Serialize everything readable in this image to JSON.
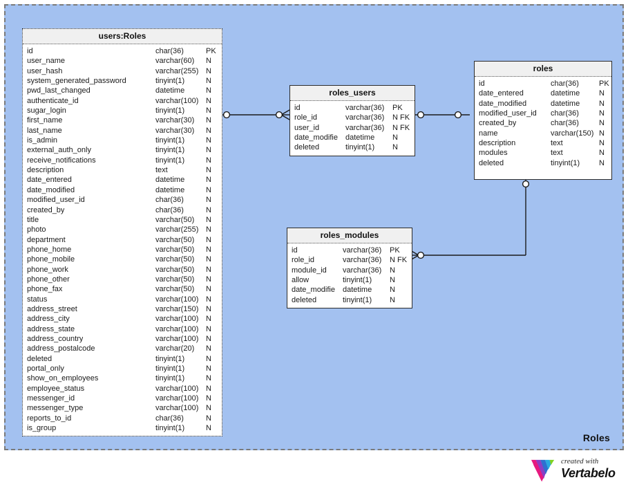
{
  "diagram": {
    "title": "Roles",
    "background_color": "#a3c1f0",
    "border_style": "dashed",
    "notation": "crow's-foot"
  },
  "tables": {
    "users": {
      "name": "users:Roles",
      "border_style": "dotted",
      "columns": [
        {
          "name": "id",
          "type": "char(36)",
          "flags": "PK"
        },
        {
          "name": "user_name",
          "type": "varchar(60)",
          "flags": "N"
        },
        {
          "name": "user_hash",
          "type": "varchar(255)",
          "flags": "N"
        },
        {
          "name": "system_generated_password",
          "type": "tinyint(1)",
          "flags": "N"
        },
        {
          "name": "pwd_last_changed",
          "type": "datetime",
          "flags": "N"
        },
        {
          "name": "authenticate_id",
          "type": "varchar(100)",
          "flags": "N"
        },
        {
          "name": "sugar_login",
          "type": "tinyint(1)",
          "flags": "N"
        },
        {
          "name": "first_name",
          "type": "varchar(30)",
          "flags": "N"
        },
        {
          "name": "last_name",
          "type": "varchar(30)",
          "flags": "N"
        },
        {
          "name": "is_admin",
          "type": "tinyint(1)",
          "flags": "N"
        },
        {
          "name": "external_auth_only",
          "type": "tinyint(1)",
          "flags": "N"
        },
        {
          "name": "receive_notifications",
          "type": "tinyint(1)",
          "flags": "N"
        },
        {
          "name": "description",
          "type": "text",
          "flags": "N"
        },
        {
          "name": "date_entered",
          "type": "datetime",
          "flags": "N"
        },
        {
          "name": "date_modified",
          "type": "datetime",
          "flags": "N"
        },
        {
          "name": "modified_user_id",
          "type": "char(36)",
          "flags": "N"
        },
        {
          "name": "created_by",
          "type": "char(36)",
          "flags": "N"
        },
        {
          "name": "title",
          "type": "varchar(50)",
          "flags": "N"
        },
        {
          "name": "photo",
          "type": "varchar(255)",
          "flags": "N"
        },
        {
          "name": "department",
          "type": "varchar(50)",
          "flags": "N"
        },
        {
          "name": "phone_home",
          "type": "varchar(50)",
          "flags": "N"
        },
        {
          "name": "phone_mobile",
          "type": "varchar(50)",
          "flags": "N"
        },
        {
          "name": "phone_work",
          "type": "varchar(50)",
          "flags": "N"
        },
        {
          "name": "phone_other",
          "type": "varchar(50)",
          "flags": "N"
        },
        {
          "name": "phone_fax",
          "type": "varchar(50)",
          "flags": "N"
        },
        {
          "name": "status",
          "type": "varchar(100)",
          "flags": "N"
        },
        {
          "name": "address_street",
          "type": "varchar(150)",
          "flags": "N"
        },
        {
          "name": "address_city",
          "type": "varchar(100)",
          "flags": "N"
        },
        {
          "name": "address_state",
          "type": "varchar(100)",
          "flags": "N"
        },
        {
          "name": "address_country",
          "type": "varchar(100)",
          "flags": "N"
        },
        {
          "name": "address_postalcode",
          "type": "varchar(20)",
          "flags": "N"
        },
        {
          "name": "deleted",
          "type": "tinyint(1)",
          "flags": "N"
        },
        {
          "name": "portal_only",
          "type": "tinyint(1)",
          "flags": "N"
        },
        {
          "name": "show_on_employees",
          "type": "tinyint(1)",
          "flags": "N"
        },
        {
          "name": "employee_status",
          "type": "varchar(100)",
          "flags": "N"
        },
        {
          "name": "messenger_id",
          "type": "varchar(100)",
          "flags": "N"
        },
        {
          "name": "messenger_type",
          "type": "varchar(100)",
          "flags": "N"
        },
        {
          "name": "reports_to_id",
          "type": "char(36)",
          "flags": "N"
        },
        {
          "name": "is_group",
          "type": "tinyint(1)",
          "flags": "N"
        }
      ]
    },
    "roles_users": {
      "name": "roles_users",
      "border_style": "solid",
      "columns": [
        {
          "name": "id",
          "type": "varchar(36)",
          "flags": "PK"
        },
        {
          "name": "role_id",
          "type": "varchar(36)",
          "flags": "N FK"
        },
        {
          "name": "user_id",
          "type": "varchar(36)",
          "flags": "N FK"
        },
        {
          "name": "date_modifie",
          "type": "datetime",
          "flags": "N"
        },
        {
          "name": "deleted",
          "type": "tinyint(1)",
          "flags": "N"
        }
      ]
    },
    "roles": {
      "name": "roles",
      "border_style": "solid",
      "columns": [
        {
          "name": "id",
          "type": "char(36)",
          "flags": "PK"
        },
        {
          "name": "date_entered",
          "type": "datetime",
          "flags": "N"
        },
        {
          "name": "date_modified",
          "type": "datetime",
          "flags": "N"
        },
        {
          "name": "modified_user_id",
          "type": "char(36)",
          "flags": "N"
        },
        {
          "name": "created_by",
          "type": "char(36)",
          "flags": "N"
        },
        {
          "name": "name",
          "type": "varchar(150)",
          "flags": "N"
        },
        {
          "name": "description",
          "type": "text",
          "flags": "N"
        },
        {
          "name": "modules",
          "type": "text",
          "flags": "N"
        },
        {
          "name": "deleted",
          "type": "tinyint(1)",
          "flags": "N"
        }
      ]
    },
    "roles_modules": {
      "name": "roles_modules",
      "border_style": "solid",
      "columns": [
        {
          "name": "id",
          "type": "varchar(36)",
          "flags": "PK"
        },
        {
          "name": "role_id",
          "type": "varchar(36)",
          "flags": "N FK"
        },
        {
          "name": "module_id",
          "type": "varchar(36)",
          "flags": "N"
        },
        {
          "name": "allow",
          "type": "tinyint(1)",
          "flags": "N"
        },
        {
          "name": "date_modifie",
          "type": "datetime",
          "flags": "N"
        },
        {
          "name": "deleted",
          "type": "tinyint(1)",
          "flags": "N"
        }
      ]
    }
  },
  "relationships": [
    {
      "from": "users",
      "to": "roles_users",
      "from_cardinality": "zero-or-one",
      "to_cardinality": "zero-or-many"
    },
    {
      "from": "roles_users",
      "to": "roles",
      "from_cardinality": "zero-or-many",
      "to_cardinality": "zero-or-one"
    },
    {
      "from": "roles_modules",
      "to": "roles",
      "from_cardinality": "zero-or-many",
      "to_cardinality": "zero-or-one"
    }
  ],
  "footer": {
    "created_with": "created with",
    "brand": "Vertabelo",
    "logo_colors": [
      "#e5197f",
      "#8b3ec4",
      "#2f6fd0",
      "#2aa9e0",
      "#7ed321"
    ]
  }
}
